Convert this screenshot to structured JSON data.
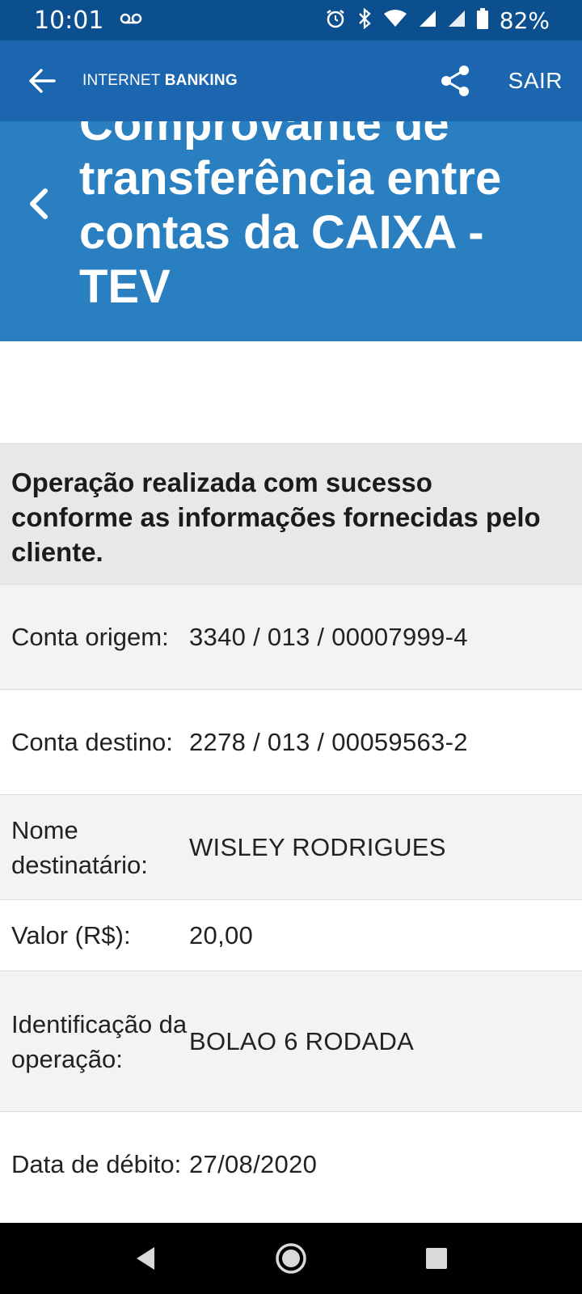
{
  "status_bar": {
    "time": "10:01",
    "battery": "82%",
    "icons": [
      "voicemail-icon",
      "alarm-icon",
      "bluetooth-icon",
      "wifi-icon",
      "signal-icon",
      "signal-icon",
      "battery-icon"
    ]
  },
  "app_bar": {
    "title_regular": "INTERNET",
    "title_bold": "BANKING",
    "logout_label": "SAIR"
  },
  "hero": {
    "title": "Comprovante de transferência entre contas da CAIXA - TEV"
  },
  "message": "Operação realizada com sucesso conforme as informações fornecidas pelo cliente.",
  "details": [
    {
      "label": "Conta origem:",
      "value": "3340 / 013 / 00007999-4"
    },
    {
      "label": "Conta destino:",
      "value": "2278 / 013 / 00059563-2"
    },
    {
      "label": "Nome destinatário:",
      "value": "WISLEY RODRIGUES"
    },
    {
      "label": "Valor (R$):",
      "value": "20,00"
    },
    {
      "label": "Identificação da operação:",
      "value": "BOLAO 6 RODADA"
    },
    {
      "label": "Data de débito:",
      "value": "27/08/2020"
    }
  ],
  "colors": {
    "status_bar": "#0c4f8f",
    "app_bar": "#1c66b0",
    "hero": "#2a7fc0",
    "banner": "#e8e8e8",
    "row_shade": "#f4f2f2"
  }
}
